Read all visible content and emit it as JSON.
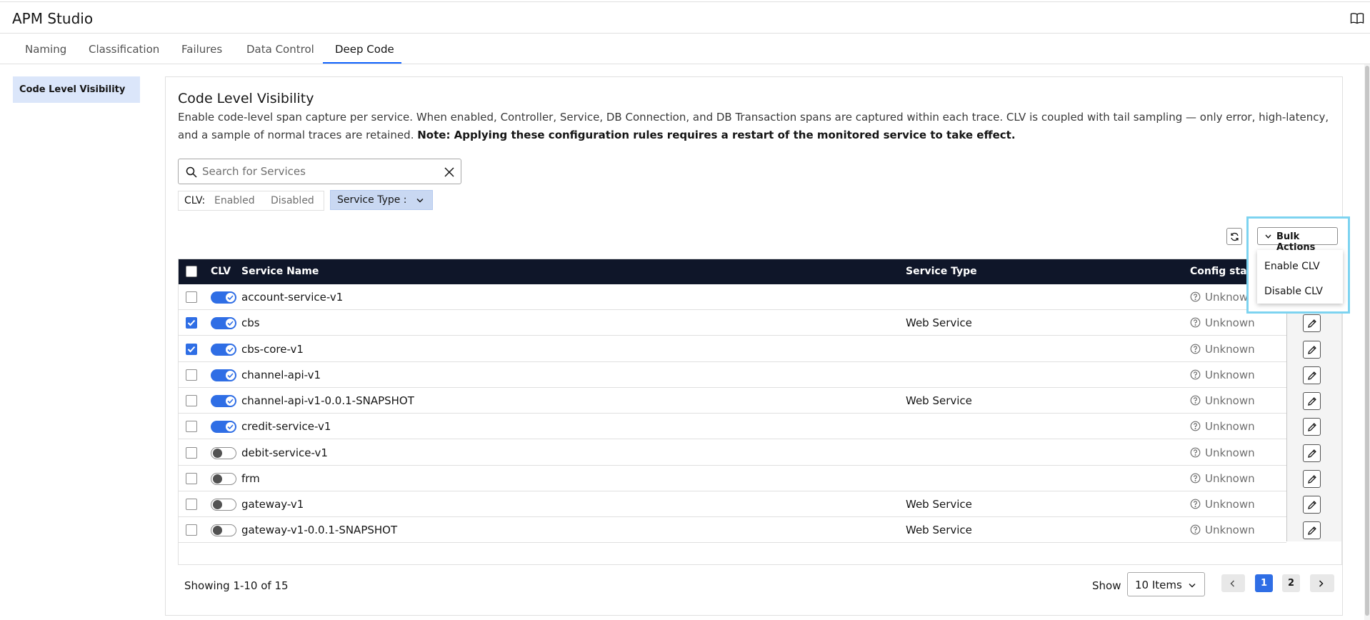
{
  "app": {
    "title": "APM Studio"
  },
  "tabs": [
    {
      "label": "Naming"
    },
    {
      "label": "Classification"
    },
    {
      "label": "Failures"
    },
    {
      "label": "Data Control"
    },
    {
      "label": "Deep Code",
      "active": true
    }
  ],
  "sidebar": {
    "items": [
      {
        "label": "Code Level Visibility",
        "active": true
      }
    ]
  },
  "panel": {
    "title": "Code Level Visibility",
    "description": "Enable code-level span capture per service. When enabled, Controller, Service, DB Connection, and DB Transaction spans are captured within each trace. CLV is coupled with tail sampling — only error, high-latency, and a sample of normal traces are retained.",
    "note": "Note: Applying these configuration rules requires a restart of the monitored service to take effect."
  },
  "search": {
    "placeholder": "Search for Services",
    "value": ""
  },
  "filters": {
    "clv_label": "CLV:",
    "clv_enabled": "Enabled",
    "clv_disabled": "Disabled",
    "service_type_label": "Service Type :"
  },
  "bulk_actions": {
    "label": "Bulk Actions",
    "menu": [
      "Enable CLV",
      "Disable CLV"
    ]
  },
  "table": {
    "headers": {
      "clv": "CLV",
      "service_name": "Service Name",
      "service_type": "Service Type",
      "config_status": "Config stat"
    },
    "rows": [
      {
        "selected": false,
        "clv": true,
        "name": "account-service-v1",
        "type": "",
        "status": "Unknown"
      },
      {
        "selected": true,
        "clv": true,
        "name": "cbs",
        "type": "Web Service",
        "status": "Unknown"
      },
      {
        "selected": true,
        "clv": true,
        "name": "cbs-core-v1",
        "type": "",
        "status": "Unknown"
      },
      {
        "selected": false,
        "clv": true,
        "name": "channel-api-v1",
        "type": "",
        "status": "Unknown"
      },
      {
        "selected": false,
        "clv": true,
        "name": "channel-api-v1-0.0.1-SNAPSHOT",
        "type": "Web Service",
        "status": "Unknown"
      },
      {
        "selected": false,
        "clv": true,
        "name": "credit-service-v1",
        "type": "",
        "status": "Unknown"
      },
      {
        "selected": false,
        "clv": false,
        "name": "debit-service-v1",
        "type": "",
        "status": "Unknown"
      },
      {
        "selected": false,
        "clv": false,
        "name": "frm",
        "type": "",
        "status": "Unknown"
      },
      {
        "selected": false,
        "clv": false,
        "name": "gateway-v1",
        "type": "Web Service",
        "status": "Unknown"
      },
      {
        "selected": false,
        "clv": false,
        "name": "gateway-v1-0.0.1-SNAPSHOT",
        "type": "Web Service",
        "status": "Unknown"
      }
    ]
  },
  "pagination": {
    "showing": "Showing 1-10 of 15",
    "show_label": "Show",
    "items_per_page": "10 Items",
    "pages": [
      "1",
      "2"
    ],
    "current_page": "1"
  },
  "colors": {
    "accent": "#2f6ee5",
    "header_bg": "#0f1629",
    "highlight": "#7dd3f0",
    "filter_chip": "#c9d8f2"
  },
  "icons": [
    "book-icon",
    "search-icon",
    "close-icon",
    "chevron-down-icon",
    "refresh-icon",
    "help-circle-icon",
    "pencil-icon",
    "chevron-left-icon",
    "chevron-right-icon",
    "checkmark-icon"
  ]
}
